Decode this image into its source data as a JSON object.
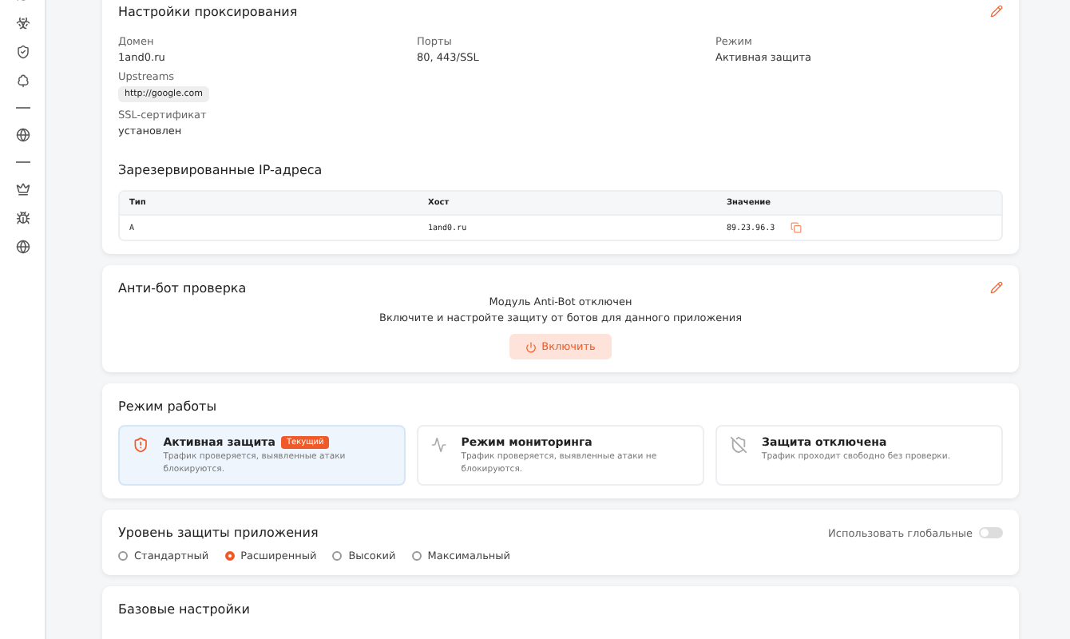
{
  "proxy_settings": {
    "title": "Настройки проксирования",
    "fields": [
      {
        "label": "Домен",
        "value": "1and0.ru"
      },
      {
        "label": "Порты",
        "value": "80, 443/SSL"
      },
      {
        "label": "Режим",
        "value": "Активная защита"
      }
    ],
    "upstreams": {
      "label": "Upstreams",
      "tags": [
        "http://google.com"
      ]
    },
    "ssl": {
      "label": "SSL-сертификат",
      "value": "установлен"
    },
    "reserved_ips": {
      "title": "Зарезервированные IP-адреса",
      "columns": [
        "Тип",
        "Хост",
        "Значение"
      ],
      "rows": [
        [
          "A",
          "1and0.ru",
          "89.23.96.3"
        ]
      ]
    }
  },
  "antibot": {
    "title": "Анти-бот проверка",
    "message": "Модуль Anti-Bot отключен",
    "hint": "Включите и настройте защиту от ботов для данного приложения",
    "button": "Включить"
  },
  "work_mode": {
    "title": "Режим работы",
    "modes": [
      {
        "kind": "shield",
        "title": "Активная защита",
        "badge": "Текущий",
        "description": "Трафик проверяется, выявленные атаки блокируются.",
        "selected": true
      },
      {
        "kind": "pulse",
        "title": "Режим мониторинга",
        "description": "Трафик проверяется, выявленные атаки не блокируются.",
        "selected": false
      },
      {
        "kind": "off",
        "title": "Защита отключена",
        "description": "Трафик проходит свободно без проверки.",
        "selected": false
      }
    ]
  },
  "protection_level": {
    "title": "Уровень защиты приложения",
    "global_toggle": {
      "label": "Использовать глобальные",
      "on": false
    },
    "options": [
      {
        "label": "Стандартный",
        "selected": false
      },
      {
        "label": "Расширенный",
        "selected": true
      },
      {
        "label": "Высокий",
        "selected": false
      },
      {
        "label": "Максимальный",
        "selected": false
      }
    ]
  },
  "basic_settings": {
    "title": "Базовые настройки"
  }
}
